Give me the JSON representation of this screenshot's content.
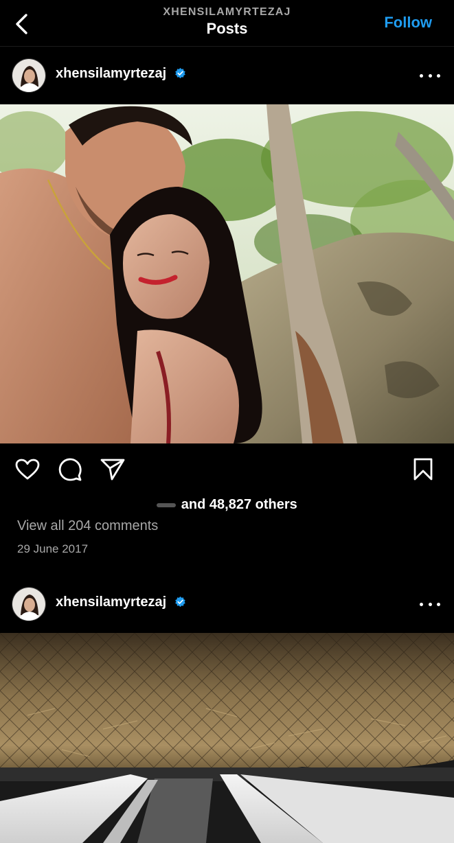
{
  "header": {
    "username": "XHENSILAMYRTEZAJ",
    "title": "Posts",
    "follow_label": "Follow"
  },
  "posts": [
    {
      "username": "xhensilamyrtezaj",
      "verified": true,
      "likes_text": "and 48,827 others",
      "view_comments": "View all 204 comments",
      "date": "29 June 2017"
    },
    {
      "username": "xhensilamyrtezaj",
      "verified": true
    }
  ],
  "icons": {
    "back": "chevron-left-icon",
    "more": "more-horizontal-icon",
    "like": "heart-icon",
    "comment": "comment-icon",
    "share": "send-icon",
    "save": "bookmark-icon",
    "verified": "verified-badge-icon"
  },
  "colors": {
    "accent": "#1f9cf0",
    "background": "#000000",
    "secondary_text": "#a8a8a8"
  }
}
